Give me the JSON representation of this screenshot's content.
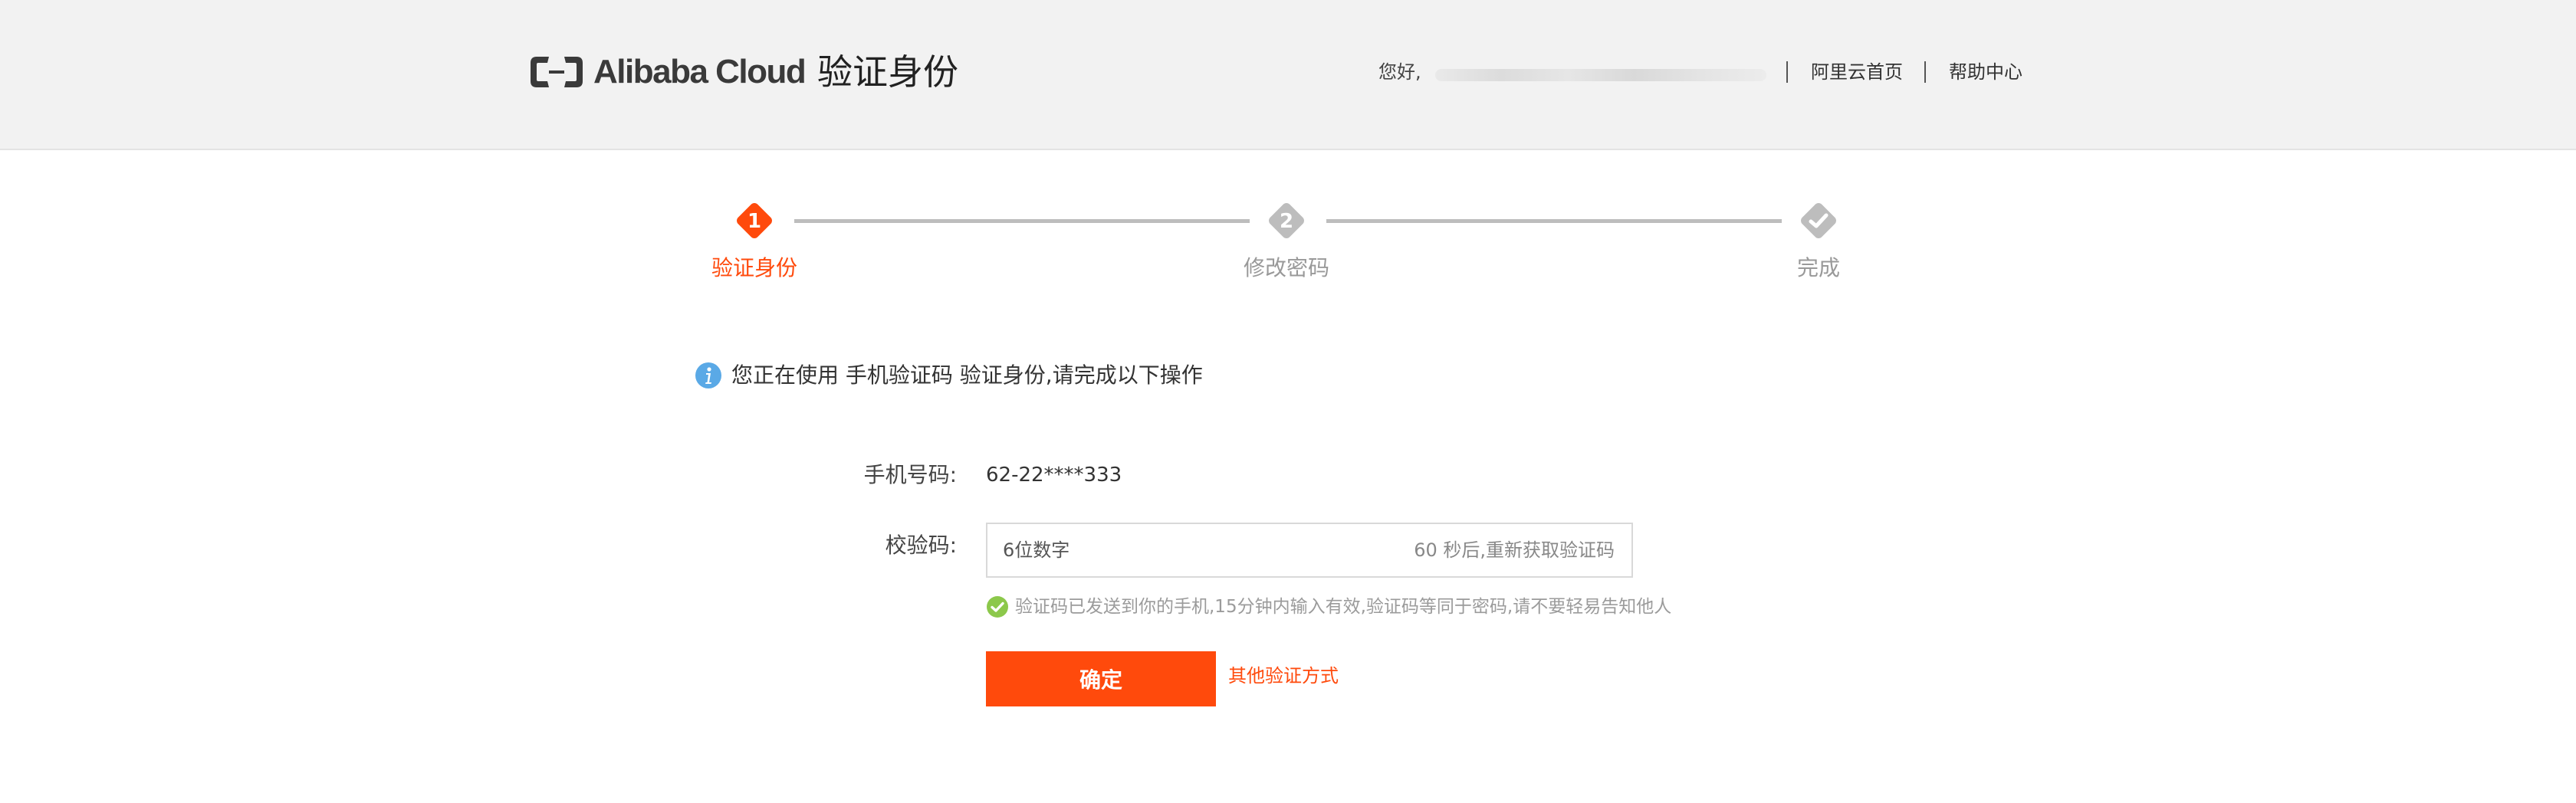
{
  "header": {
    "logo_text": "Alibaba Cloud",
    "title": "验证身份",
    "greeting": "您好,",
    "links": [
      "阿里云首页",
      "帮助中心"
    ]
  },
  "steps": [
    {
      "number": "1",
      "label": "验证身份",
      "state": "active"
    },
    {
      "number": "2",
      "label": "修改密码",
      "state": "pending"
    },
    {
      "number": "check-icon",
      "label": "完成",
      "state": "pending"
    }
  ],
  "notice": {
    "icon": "info-icon",
    "text": "您正在使用 手机验证码 验证身份,请完成以下操作"
  },
  "form": {
    "phone_label": "手机号码:",
    "phone_value": "62-22****333",
    "code_label": "校验码:",
    "code_placeholder": "6位数字",
    "resend_text": "60 秒后,重新获取验证码",
    "hint_icon": "check-circle-icon",
    "hint_text": "验证码已发送到你的手机,15分钟内输入有效,验证码等同于密码,请不要轻易告知他人",
    "confirm_label": "确定",
    "other_method_label": "其他验证方式"
  },
  "colors": {
    "accent": "#ff4a0c",
    "step_inactive": "#bdbdbd",
    "info_blue": "#5aa9e6",
    "hint_green": "#8cc84b"
  }
}
